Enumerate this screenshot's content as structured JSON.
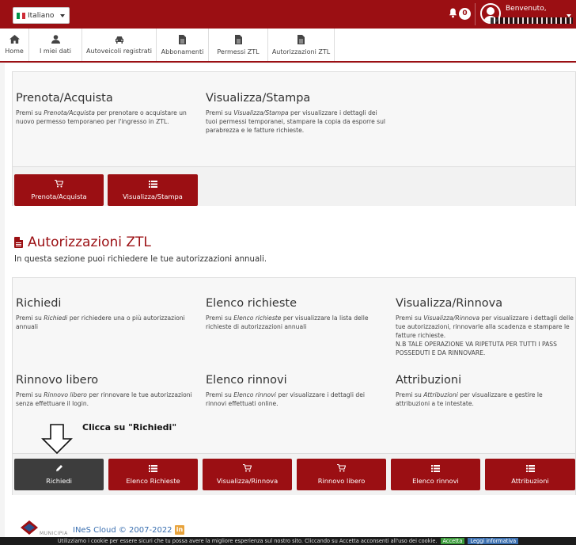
{
  "header": {
    "language": "Italiano",
    "notifications_count": "0",
    "welcome": "Benvenuto,"
  },
  "nav": {
    "items": [
      {
        "label": "Home",
        "icon": "home-icon"
      },
      {
        "label": "I miei dati",
        "icon": "user-icon"
      },
      {
        "label": "Autoveicoli registrati",
        "icon": "car-icon"
      },
      {
        "label": "Abbonamenti",
        "icon": "file-icon"
      },
      {
        "label": "Permessi ZTL",
        "icon": "file-icon"
      },
      {
        "label": "Autorizzazioni ZTL",
        "icon": "file-icon"
      }
    ]
  },
  "permessi_panel": {
    "columns": [
      {
        "title": "Prenota/Acquista",
        "desc_pre": "Premi su ",
        "desc_em": "Prenota/Acquista",
        "desc_post": " per prenotare o acquistare un nuovo permesso temporaneo per l'ingresso in ZTL."
      },
      {
        "title": "Visualizza/Stampa",
        "desc_pre": "Premi su ",
        "desc_em": "Visualizza/Stampa",
        "desc_post": " per visualizzare i dettagli dei tuoi permessi temporanei, stampare la copia da esporre sul parabrezza e le fatture richieste."
      }
    ],
    "buttons": [
      {
        "label": "Prenota/Acquista",
        "icon": "cart-icon"
      },
      {
        "label": "Visualizza/Stampa",
        "icon": "list-icon"
      }
    ]
  },
  "autorizzazioni": {
    "title": "Autorizzazioni ZTL",
    "subtitle": "In questa sezione puoi richiedere le tue autorizzazioni annuali.",
    "columns": [
      {
        "title": "Richiedi",
        "desc_pre": "Premi su ",
        "desc_em": "Richiedi",
        "desc_post": " per richiedere una o più autorizzazioni annuali"
      },
      {
        "title": "Elenco richieste",
        "desc_pre": "Premi su ",
        "desc_em": "Elenco richieste",
        "desc_post": " per visualizzare la lista delle richieste di autorizzazioni annuali"
      },
      {
        "title": "Visualizza/Rinnova",
        "desc_pre": "Premi su ",
        "desc_em": "Visualizza/Rinnova",
        "desc_post": " per visualizzare i dettagli delle tue autorizzazioni, rinnovarle alla scadenza e stampare le fatture richieste.",
        "note": "N.B TALE OPERAZIONE VA RIPETUTA PER TUTTI I PASS POSSEDUTI E DA RINNOVARE."
      },
      {
        "title": "Rinnovo libero",
        "desc_pre": "Premi su ",
        "desc_em": "Rinnovo libero",
        "desc_post": " per rinnovare le tue autorizzazioni senza effettuare il login."
      },
      {
        "title": "Elenco rinnovi",
        "desc_pre": "Premi su ",
        "desc_em": "Elenco rinnovi",
        "desc_post": " per visualizzare i dettagli dei rinnovi effettuati online."
      },
      {
        "title": "Attribuzioni",
        "desc_pre": "Premi su ",
        "desc_em": "Attribuzioni",
        "desc_post": " per visualizzare e gestire le attribuzioni a te intestate."
      }
    ],
    "hint": "Clicca su \"Richiedi\"",
    "buttons": [
      {
        "label": "Richiedi",
        "icon": "pencil-icon"
      },
      {
        "label": "Elenco Richieste",
        "icon": "list-icon"
      },
      {
        "label": "Visualizza/Rinnova",
        "icon": "cart-icon"
      },
      {
        "label": "Rinnovo libero",
        "icon": "cart-icon"
      },
      {
        "label": "Elenco rinnovi",
        "icon": "list-icon"
      },
      {
        "label": "Attribuzioni",
        "icon": "list-icon"
      }
    ]
  },
  "footer": {
    "municipality": "MUNICIPIA",
    "copyright": "INeS Cloud © 2007-2022",
    "linkedin": "in"
  },
  "cookie": {
    "text": "Utilizziamo i cookie per essere sicuri che tu possa avere la migliore esperienza sul nostro sito. Cliccando su Accetta acconsenti all'uso dei cookie.",
    "accept": "Accetta",
    "info": "Leggi informativa"
  },
  "colors": {
    "brand_red": "#9b0f13",
    "dark_button": "#3d3d3d"
  }
}
